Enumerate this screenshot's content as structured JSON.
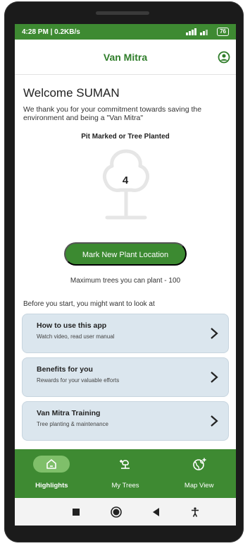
{
  "status_bar": {
    "time_speed": "4:28 PM | 0.2KB/s",
    "battery": "76"
  },
  "app_bar": {
    "title": "Van Mitra",
    "account_icon": "account-circle-icon"
  },
  "welcome": {
    "greeting": "Welcome SUMAN",
    "message": "We thank you for your commitment towards saving the environment and being a \"Van Mitra\""
  },
  "stats": {
    "label": "Pit Marked or Tree Planted",
    "count": "4"
  },
  "primary_action": {
    "label": "Mark New Plant Location"
  },
  "limit_note": "Maximum trees you can plant - 100",
  "resources": {
    "heading": "Before you start, you might want to look at",
    "cards": [
      {
        "title": "How to use this app",
        "subtitle": "Watch video, read user manual"
      },
      {
        "title": "Benefits for you",
        "subtitle": "Rewards for your valuable efforts"
      },
      {
        "title": "Van Mitra Training",
        "subtitle": "Tree planting & maintenance"
      }
    ]
  },
  "bottom_nav": {
    "items": [
      {
        "label": "Highlights",
        "icon": "home-icon",
        "active": true
      },
      {
        "label": "My Trees",
        "icon": "plant-icon",
        "active": false
      },
      {
        "label": "Map View",
        "icon": "globe-icon",
        "active": false
      }
    ]
  },
  "colors": {
    "brand_green": "#3e8a32",
    "active_pill": "#7fbf6a",
    "card_bg": "#dbe6ee"
  }
}
